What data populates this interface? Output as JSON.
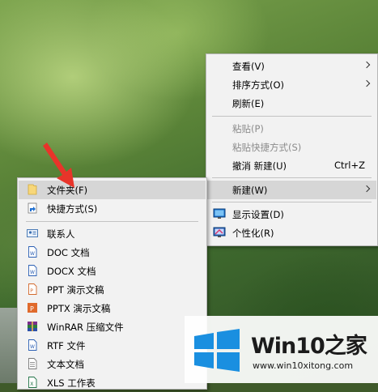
{
  "context_menu": {
    "items": [
      {
        "label": "查看(V)"
      },
      {
        "label": "排序方式(O)"
      },
      {
        "label": "刷新(E)"
      },
      {
        "label": "粘贴(P)"
      },
      {
        "label": "粘贴快捷方式(S)"
      },
      {
        "label": "撤消 新建(U)",
        "accel": "Ctrl+Z"
      },
      {
        "label": "新建(W)"
      },
      {
        "label": "显示设置(D)"
      },
      {
        "label": "个性化(R)"
      }
    ]
  },
  "new_submenu": {
    "items": [
      {
        "label": "文件夹(F)"
      },
      {
        "label": "快捷方式(S)"
      },
      {
        "label": "联系人"
      },
      {
        "label": "DOC 文档"
      },
      {
        "label": "DOCX 文档"
      },
      {
        "label": "PPT 演示文稿"
      },
      {
        "label": "PPTX 演示文稿"
      },
      {
        "label": "WinRAR 压缩文件"
      },
      {
        "label": "RTF 文件"
      },
      {
        "label": "文本文档"
      },
      {
        "label": "XLS 工作表"
      }
    ]
  },
  "watermark": {
    "title": "Win10之家",
    "url": "www.win10xitong.com"
  },
  "colors": {
    "menu_bg": "#f2f2f2",
    "highlight": "#d6d6d6",
    "disabled_text": "#8c8c8c",
    "annotation_arrow": "#e8342a",
    "win_logo": "#1a8fe0"
  }
}
